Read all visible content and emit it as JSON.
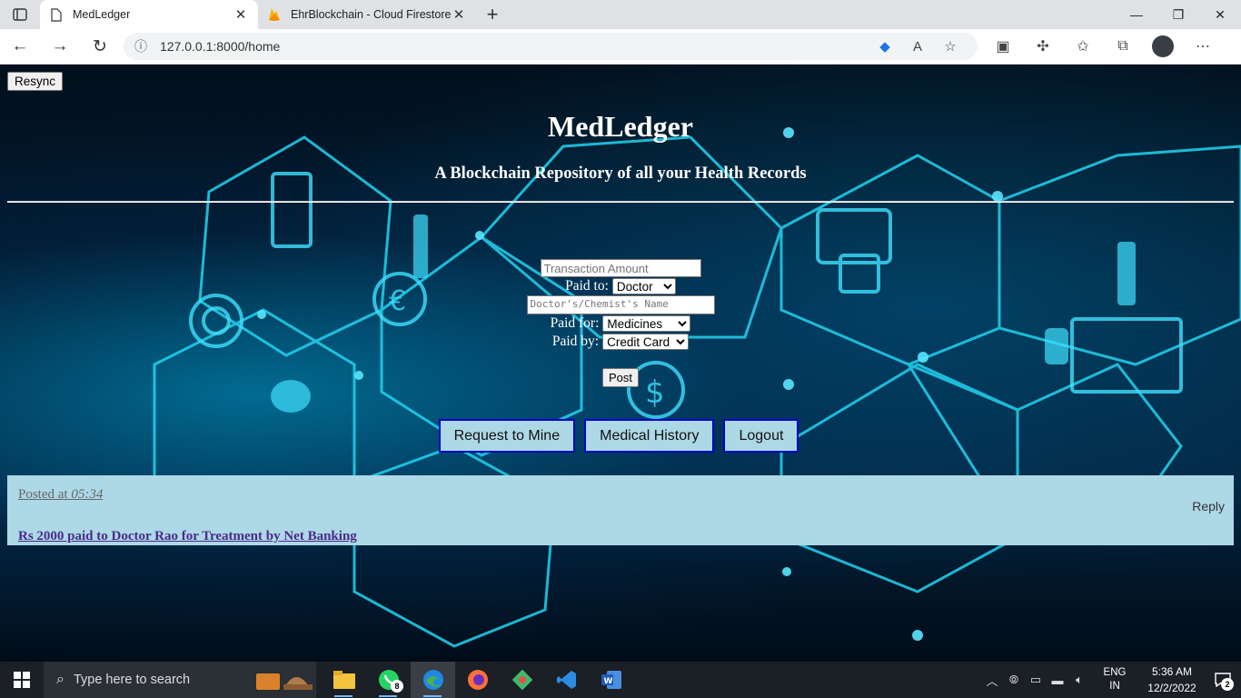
{
  "browser": {
    "tabs": [
      {
        "title": "MedLedger",
        "active": true
      },
      {
        "title": "EhrBlockchain - Cloud Firestore -",
        "active": false
      }
    ],
    "url": "127.0.0.1:8000/home",
    "new_tab_symbol": "+"
  },
  "page": {
    "resync_label": "Resync",
    "title": "MedLedger",
    "subtitle": "A Blockchain Repository of all your Health Records",
    "form": {
      "amount_placeholder": "Transaction Amount",
      "paid_to_label": "Paid to:",
      "paid_to_selected": "Doctor",
      "name_placeholder": "Doctor's/Chemist's Name",
      "paid_for_label": "Paid for:",
      "paid_for_selected": "Medicines",
      "paid_by_label": "Paid by:",
      "paid_by_selected": "Credit Card",
      "post_label": "Post"
    },
    "actions": {
      "mine_label": "Request to Mine",
      "history_label": "Medical History",
      "logout_label": "Logout"
    },
    "post": {
      "posted_prefix": "Posted at",
      "time": "05:34",
      "reply_label": "Reply",
      "text": "Rs 2000 paid to Doctor Rao for Treatment by Net Banking"
    }
  },
  "taskbar": {
    "search_placeholder": "Type here to search",
    "whatsapp_badge": "8",
    "language_line1": "ENG",
    "language_line2": "IN",
    "time": "5:36 AM",
    "date": "12/2/2022",
    "notification_count": "2"
  },
  "colors": {
    "post_bg": "#add8e6",
    "action_border": "#0000cd",
    "taskbar_bg": "#1b1f26"
  }
}
